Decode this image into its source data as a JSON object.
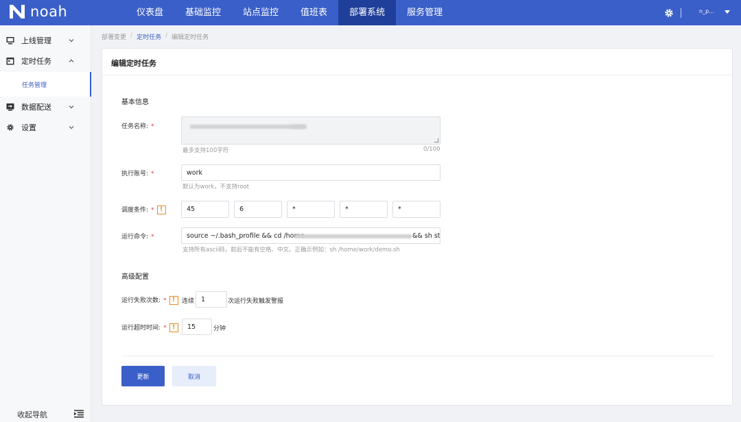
{
  "app": {
    "name": "noah"
  },
  "topnav": {
    "items": [
      "仪表盘",
      "基础监控",
      "站点监控",
      "值班表",
      "部署系统",
      "服务管理"
    ],
    "active_index": 4,
    "user": "n_p...",
    "settings_icon": "gear-icon"
  },
  "sidebar": {
    "items": [
      {
        "label": "上线管理",
        "icon": "monitor-icon",
        "expanded": false
      },
      {
        "label": "定时任务",
        "icon": "calendar-icon",
        "expanded": true
      },
      {
        "label": "数据配送",
        "icon": "transfer-icon",
        "expanded": false
      },
      {
        "label": "设置",
        "icon": "gear-icon",
        "expanded": false
      }
    ],
    "sub_item": "任务管理",
    "collapse_label": "收起导航"
  },
  "breadcrumb": [
    "部署变更",
    "定时任务",
    "编辑定时任务"
  ],
  "card": {
    "title": "编辑定时任务",
    "basic_section": "基本信息",
    "advanced_section": "高级配置"
  },
  "form": {
    "task_name": {
      "label": "任务名称:",
      "hint": "最多支持100字符",
      "counter": "0/100"
    },
    "account": {
      "label": "执行账号:",
      "value": "work",
      "hint": "默认为work，不支持root"
    },
    "schedule": {
      "label": "调度条件:",
      "values": [
        "45",
        "6",
        "*",
        "*",
        "*"
      ]
    },
    "command": {
      "label": "运行命令:",
      "value_start": "source ~/.bash_profile && cd /home",
      "value_end": "&& sh start",
      "hint": "支持所有ascii码，前后不能有空格、中文。正确示例如：sh /home/work/demo.sh"
    },
    "fail_count": {
      "label": "运行失败次数:",
      "prefix": "连续",
      "value": "1",
      "suffix": "次运行失败触发警报"
    },
    "timeout": {
      "label": "运行超时时间:",
      "value": "15",
      "suffix": "分钟"
    }
  },
  "buttons": {
    "update": "更新",
    "cancel": "取消"
  },
  "colors": {
    "primary": "#3a5fc8",
    "nav_active": "#1f3f9a",
    "required": "#e4393c",
    "warning": "#e88a1a"
  }
}
